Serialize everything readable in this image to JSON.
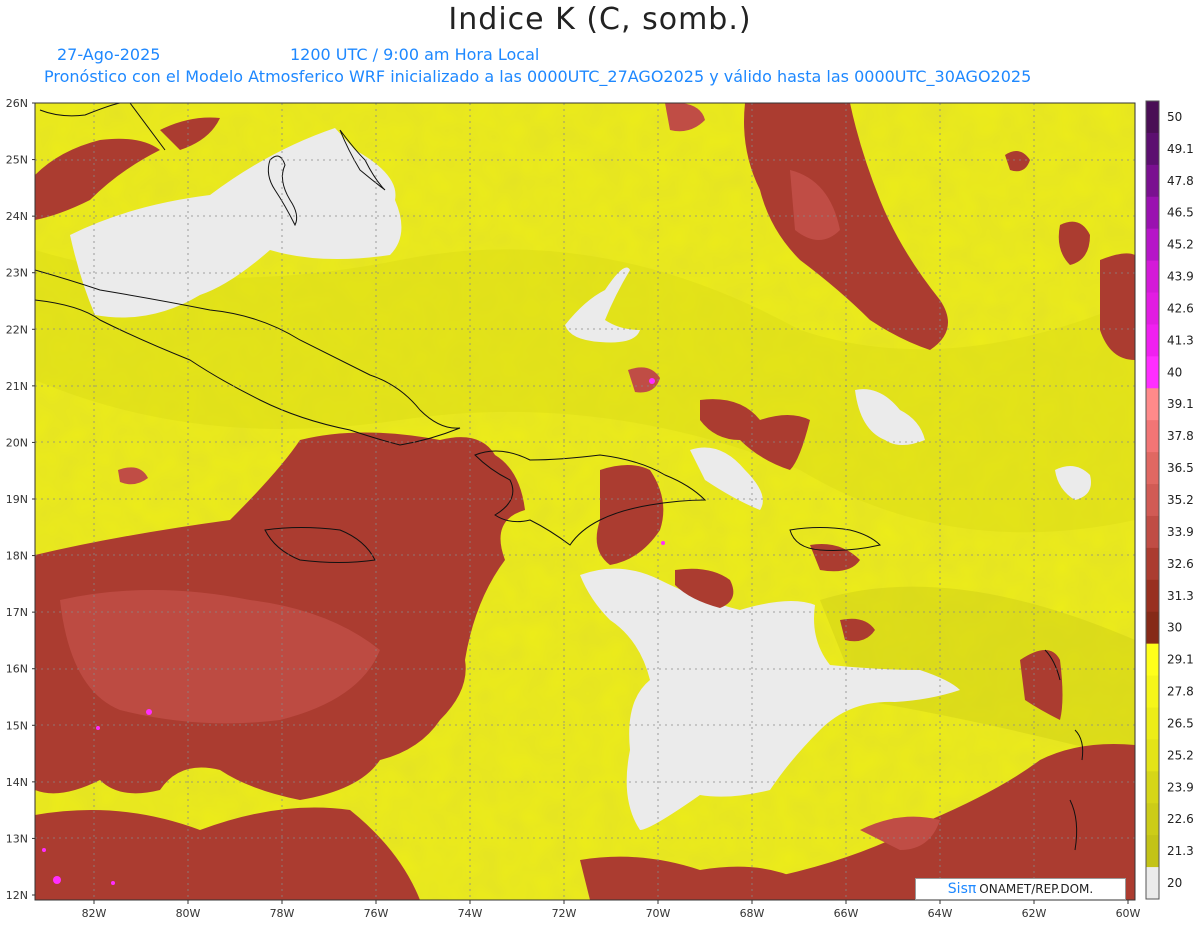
{
  "title": "Indice K (C, somb.)",
  "date": "27-Ago-2025",
  "time": "1200 UTC / 9:00 am Hora Local",
  "description": "Pronóstico con el Modelo Atmosferico WRF inicializado a las 0000UTC_27AGO2025 y válido hasta las  0000UTC_30AGO2025",
  "lat_labels": [
    "26N",
    "25N",
    "24N",
    "23N",
    "22N",
    "21N",
    "20N",
    "19N",
    "18N",
    "17N",
    "16N",
    "15N",
    "14N",
    "13N",
    "12N"
  ],
  "lon_labels": [
    "82W",
    "80W",
    "78W",
    "76W",
    "74W",
    "72W",
    "70W",
    "68W",
    "66W",
    "64W",
    "62W",
    "60W"
  ],
  "colorbar": {
    "labels": [
      "50",
      "49.1",
      "47.8",
      "46.5",
      "45.2",
      "43.9",
      "42.6",
      "41.3",
      "40",
      "39.1",
      "37.8",
      "36.5",
      "35.2",
      "33.9",
      "32.6",
      "31.3",
      "30",
      "29.1",
      "27.8",
      "26.5",
      "25.2",
      "23.9",
      "22.6",
      "21.3",
      "20"
    ],
    "colors": [
      "#4a0e55",
      "#5c0f70",
      "#7a1090",
      "#9a12b0",
      "#b616c8",
      "#d41ad8",
      "#e21de2",
      "#f020f0",
      "#ff2dff",
      "#ff8a8a",
      "#f27575",
      "#e06862",
      "#d15b55",
      "#c04d45",
      "#ab3c30",
      "#983020",
      "#862a18",
      "#ffff1a",
      "#f6f619",
      "#eded18",
      "#e3e318",
      "#d6d618",
      "#cccc18",
      "#c3c317",
      "#ebebeb"
    ]
  },
  "credit": {
    "sis": "Sisπ",
    "org": " ONAMET/REP.DOM."
  }
}
